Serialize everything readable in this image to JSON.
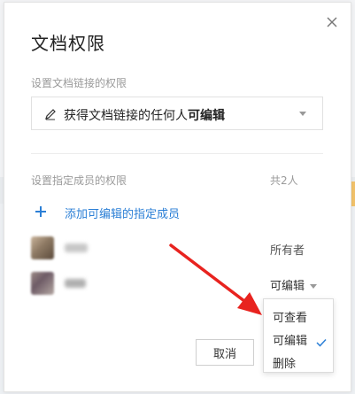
{
  "dialog": {
    "title": "文档权限",
    "close_icon": "close-icon"
  },
  "link_section": {
    "label": "设置文档链接的权限",
    "select_prefix": "获得文档链接的任何人",
    "select_value": "可编辑",
    "icon": "pencil-icon"
  },
  "members_section": {
    "label": "设置指定成员的权限",
    "count": "共2人",
    "add_label": "添加可编辑的指定成员",
    "members": [
      {
        "role": "所有者"
      },
      {
        "role": "可编辑"
      }
    ]
  },
  "permission_menu": {
    "options": [
      "可查看",
      "可编辑",
      "删除"
    ],
    "selected": "可编辑"
  },
  "footer": {
    "cancel_label": "取消"
  },
  "colors": {
    "accent": "#2b7fd6",
    "arrow": "#e8231f"
  }
}
